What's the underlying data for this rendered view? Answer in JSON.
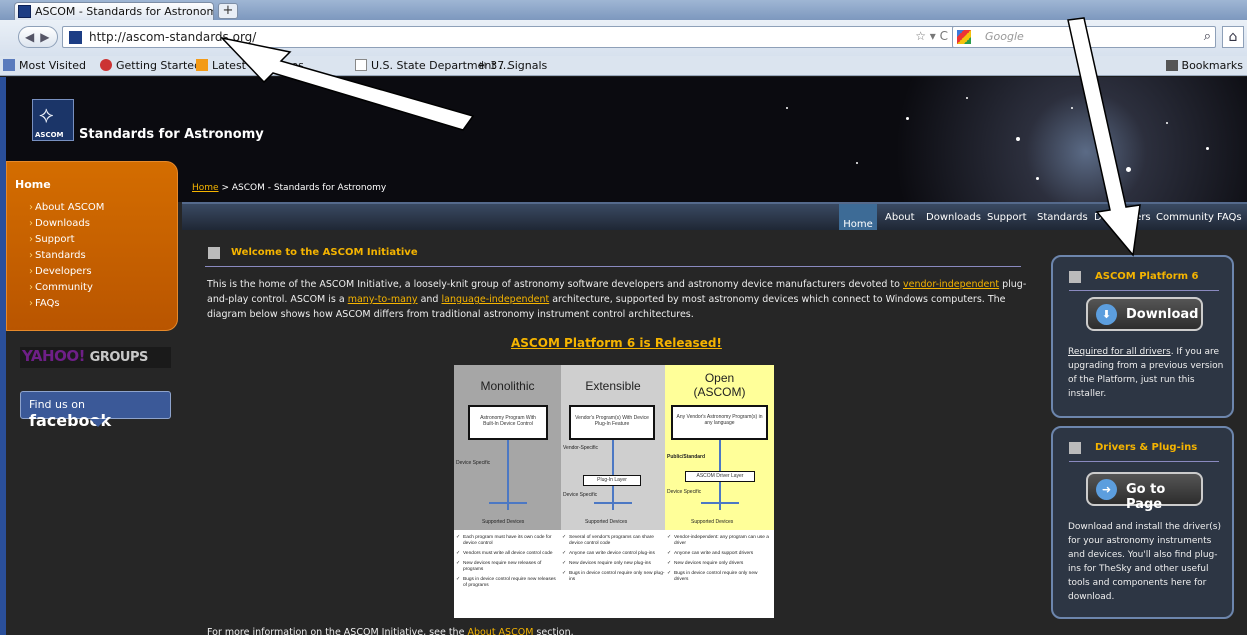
{
  "browser": {
    "tab_title": "ASCOM - Standards for Astronomy",
    "new_tab": "+",
    "url": "http://ascom-standards.org/",
    "search_placeholder": "Google",
    "bookmarks": [
      "Most Visited",
      "Getting Started",
      "Latest Headlines",
      "U.S. State Department ...",
      "37 Signals"
    ],
    "bookmarks_menu": "Bookmarks"
  },
  "site": {
    "logo_text": "ASCOM",
    "title": "Standards for Astronomy",
    "breadcrumb_home": "Home",
    "breadcrumb_rest": " > ASCOM - Standards for Astronomy"
  },
  "topnav": [
    "Home",
    "About",
    "Downloads",
    "Support",
    "Standards",
    "Developers",
    "Community",
    "FAQs"
  ],
  "leftnav": {
    "title": "Home",
    "items": [
      "About ASCOM",
      "Downloads",
      "Support",
      "Standards",
      "Developers",
      "Community",
      "FAQs"
    ]
  },
  "social": {
    "yahoo": "YAHOO!",
    "yahoo_groups": "GROUPS",
    "facebook_pre": "Find us on",
    "facebook": "facebook"
  },
  "main": {
    "welcome_title": "Welcome to the ASCOM Initiative",
    "intro": {
      "p1": "This is the home of the ASCOM Initiative, a loosely-knit group of astronomy software developers and astronomy device manufacturers devoted to ",
      "link1": "vendor-independent",
      "p2": " plug-and-play control. ASCOM is a ",
      "link2": "many-to-many",
      "p3": " and ",
      "link3": "language-independent",
      "p4": " architecture, supported by most astronomy devices which connect to Windows computers. The diagram below shows how ASCOM differs from traditional astronomy instrument control architectures."
    },
    "released": "ASCOM Platform 6 is Released!",
    "more_info_pre": "For more information on the ASCOM Initiative, see the ",
    "more_info_link": "About ASCOM",
    "more_info_post": " section."
  },
  "diagram": {
    "columns": [
      {
        "title": "Monolithic",
        "box": "Astronomy Program With Built-In Device Control",
        "mid_label": "Device Specific",
        "devices": "Supported Devices",
        "bullets": [
          "Each program must have its own code for device control",
          "Vendors must write all device control code",
          "New devices require new releases of programs",
          "Bugs in device control require new releases of programs"
        ]
      },
      {
        "title": "Extensible",
        "box": "Vendor's Program(s) With Device Plug-In Feature",
        "top_label": "Vendor-Specific",
        "layer": "Plug-In Layer",
        "mid_label": "Device Specific",
        "devices": "Supported Devices",
        "bullets": [
          "Several of vendor's programs can share device control code",
          "Anyone can write device control plug-ins",
          "New devices require only new plug-ins",
          "Bugs in device control require only new plug-ins"
        ]
      },
      {
        "title": "Open (ASCOM)",
        "box": "Any Vendor's Astronomy Program(s) in any language",
        "top_label": "Public/Standard",
        "layer": "ASCOM Driver Layer",
        "mid_label": "Device Specific",
        "devices": "Supported Devices",
        "bullets": [
          "Vendor-independent: any program can use a driver",
          "Anyone can write and support drivers",
          "New devices require only drivers",
          "Bugs in device control require only new drivers"
        ]
      }
    ]
  },
  "panels": {
    "platform": {
      "title": "ASCOM Platform 6",
      "button": "Download",
      "link": "Required for all drivers",
      "text": ". If you are upgrading from a previous version of the Platform, just run this installer."
    },
    "drivers": {
      "title": "Drivers & Plug-ins",
      "button": "Go to Page",
      "text": "Download and install the driver(s) for your astronomy instruments and devices. You'll also find plug-ins for TheSky and other useful tools and components here for download."
    }
  },
  "colors": {
    "accent": "#f5b400",
    "nav_orange": "#d46d00",
    "panel_border": "#6d86ad",
    "monolithic_bg": "#a6a6a6",
    "extensible_bg": "#cfcfcf",
    "open_bg": "#ffff99"
  }
}
